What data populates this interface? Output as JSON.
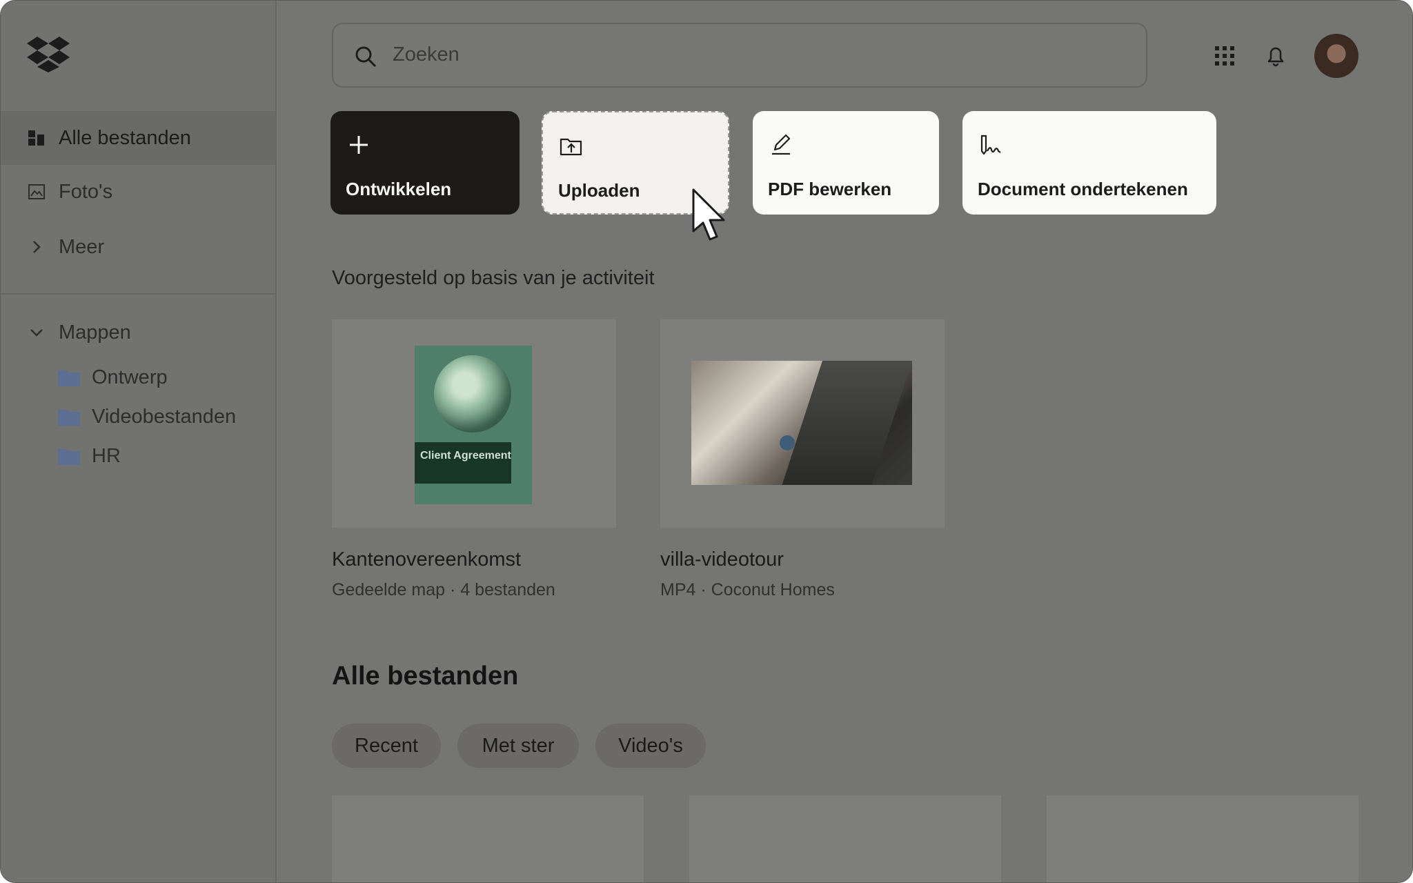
{
  "sidebar": {
    "nav": [
      {
        "label": "Alle bestanden",
        "icon": "grid-files-icon",
        "active": true
      },
      {
        "label": "Foto's",
        "icon": "photo-icon",
        "active": false
      },
      {
        "label": "Meer",
        "icon": "chevron-right-icon",
        "active": false
      }
    ],
    "folders_header": "Mappen",
    "folders": [
      {
        "label": "Ontwerp"
      },
      {
        "label": "Videobestanden"
      },
      {
        "label": "HR"
      }
    ]
  },
  "search": {
    "placeholder": "Zoeken"
  },
  "actions": [
    {
      "label": "Ontwikkelen",
      "icon": "plus-icon"
    },
    {
      "label": "Uploaden",
      "icon": "folder-upload-icon"
    },
    {
      "label": "PDF bewerken",
      "icon": "pencil-icon"
    },
    {
      "label": "Document ondertekenen",
      "icon": "signature-icon"
    }
  ],
  "suggested": {
    "heading": "Voorgesteld op basis van je activiteit",
    "items": [
      {
        "title": "Kantenovereenkomst",
        "meta": "Gedeelde map · 4 bestanden",
        "thumb_text": "Client Agreement"
      },
      {
        "title": "villa-videotour",
        "meta": "MP4 · Coconut Homes"
      }
    ]
  },
  "all_files": {
    "heading": "Alle bestanden",
    "filters": [
      "Recent",
      "Met ster",
      "Video's"
    ]
  },
  "colors": {
    "overlay": "#757574",
    "dark_button": "#1c1b1a",
    "card": "#fafaf8",
    "folder": "#5b6f92"
  }
}
